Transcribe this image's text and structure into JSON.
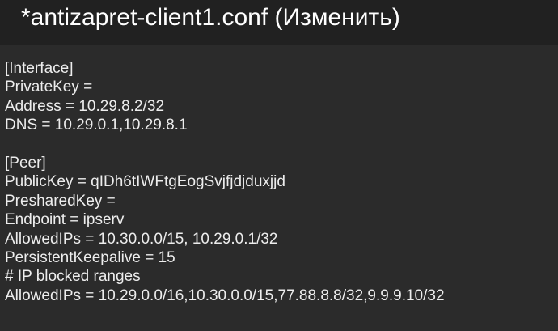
{
  "title_bar": {
    "title": "*antizapret-client1.conf (Изменить)"
  },
  "editor": {
    "lines": [
      "[Interface]",
      "PrivateKey =",
      "Address = 10.29.8.2/32",
      "DNS = 10.29.0.1,10.29.8.1",
      "",
      "[Peer]",
      "PublicKey = qIDh6tIWFtgEogSvjfjdjduxjjd",
      "PresharedKey =",
      "Endpoint = ipserv",
      "AllowedIPs = 10.30.0.0/15, 10.29.0.1/32",
      "PersistentKeepalive = 15",
      "# IP blocked ranges",
      "AllowedIPs = 10.29.0.0/16,10.30.0.0/15,77.88.8.8/32,9.9.9.10/32"
    ]
  }
}
